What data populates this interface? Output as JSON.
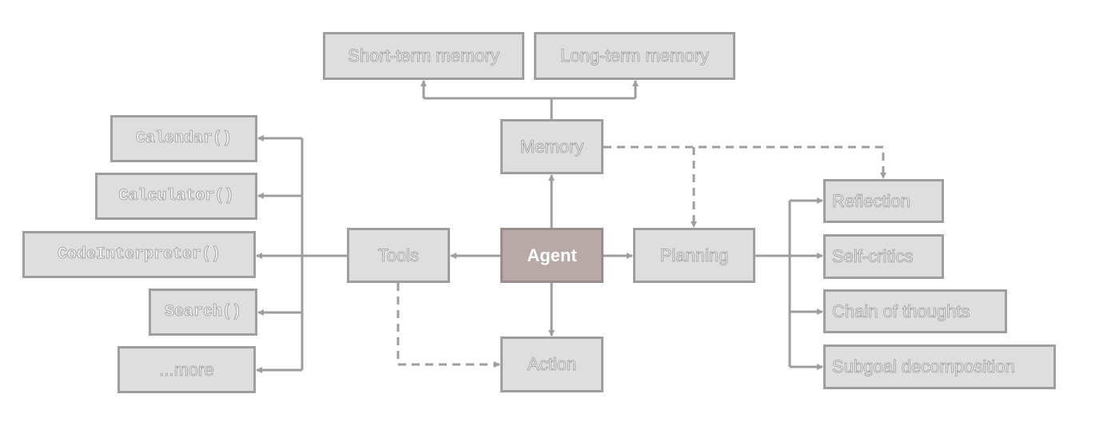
{
  "colors": {
    "box_fill": "#dedede",
    "box_border": "#9e9e9e",
    "agent_fill": "#b8a8a8",
    "line": "#9e9e9e"
  },
  "nodes": {
    "short_term_memory": "Short-term memory",
    "long_term_memory": "Long-term memory",
    "memory": "Memory",
    "calendar": "Calendar()",
    "calculator": "Calculator()",
    "code_interpreter": "CodeInterpreter()",
    "search": "Search()",
    "more": "...more",
    "tools": "Tools",
    "agent": "Agent",
    "planning": "Planning",
    "action": "Action",
    "reflection": "Reflection",
    "self_critics": "Self-critics",
    "chain_of_thoughts": "Chain of thoughts",
    "subgoal_decomposition": "Subgoal decomposition"
  },
  "edges": [
    {
      "from": "agent",
      "to": "tools",
      "style": "solid"
    },
    {
      "from": "agent",
      "to": "planning",
      "style": "solid"
    },
    {
      "from": "agent",
      "to": "memory",
      "style": "solid"
    },
    {
      "from": "agent",
      "to": "action",
      "style": "solid"
    },
    {
      "from": "memory",
      "to": "short_term_memory",
      "style": "solid"
    },
    {
      "from": "memory",
      "to": "long_term_memory",
      "style": "solid"
    },
    {
      "from": "memory",
      "to": "reflection",
      "style": "dashed"
    },
    {
      "from": "memory",
      "to": "planning",
      "style": "dashed"
    },
    {
      "from": "tools",
      "to": "action",
      "style": "dashed"
    },
    {
      "from": "tools",
      "to": "calendar",
      "style": "solid"
    },
    {
      "from": "tools",
      "to": "calculator",
      "style": "solid"
    },
    {
      "from": "tools",
      "to": "code_interpreter",
      "style": "solid"
    },
    {
      "from": "tools",
      "to": "search",
      "style": "solid"
    },
    {
      "from": "tools",
      "to": "more",
      "style": "solid"
    },
    {
      "from": "planning",
      "to": "reflection",
      "style": "solid"
    },
    {
      "from": "planning",
      "to": "self_critics",
      "style": "solid"
    },
    {
      "from": "planning",
      "to": "chain_of_thoughts",
      "style": "solid"
    },
    {
      "from": "planning",
      "to": "subgoal_decomposition",
      "style": "solid"
    }
  ]
}
